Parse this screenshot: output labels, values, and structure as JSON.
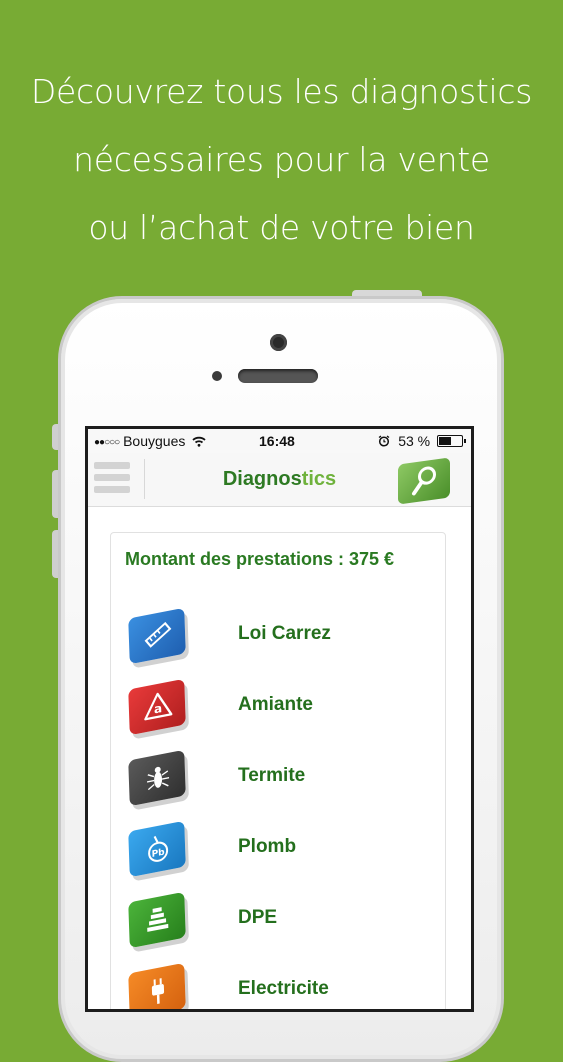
{
  "promo": {
    "line1": "Découvrez tous les diagnostics",
    "line2": "nécessaires pour la vente",
    "line3": "ou l’achat de votre bien"
  },
  "status_bar": {
    "signal": "●●○○○",
    "carrier": "Bouygues",
    "time": "16:48",
    "battery": "53 %",
    "battery_level": 0.53
  },
  "navbar": {
    "title_main": "Diagnos",
    "title_tail": "tics"
  },
  "card": {
    "title": "Montant des prestations : 375 €"
  },
  "items": [
    {
      "label": "Loi Carrez",
      "icon": "ruler-icon",
      "color": "#2f7fd1"
    },
    {
      "label": "Amiante",
      "icon": "asbestos-warning-icon",
      "color": "#d42b2b"
    },
    {
      "label": "Termite",
      "icon": "termite-icon",
      "color": "#4a4a4a"
    },
    {
      "label": "Plomb",
      "icon": "lead-pb-icon",
      "color": "#2c96dc"
    },
    {
      "label": "DPE",
      "icon": "energy-rating-icon",
      "color": "#3b9a2a"
    },
    {
      "label": "Electricite",
      "icon": "electric-plug-icon",
      "color": "#ee7b1d"
    }
  ],
  "colors": {
    "background": "#78ab34",
    "title_green": "#2e7a23",
    "accent_green": "#6fb23c"
  }
}
